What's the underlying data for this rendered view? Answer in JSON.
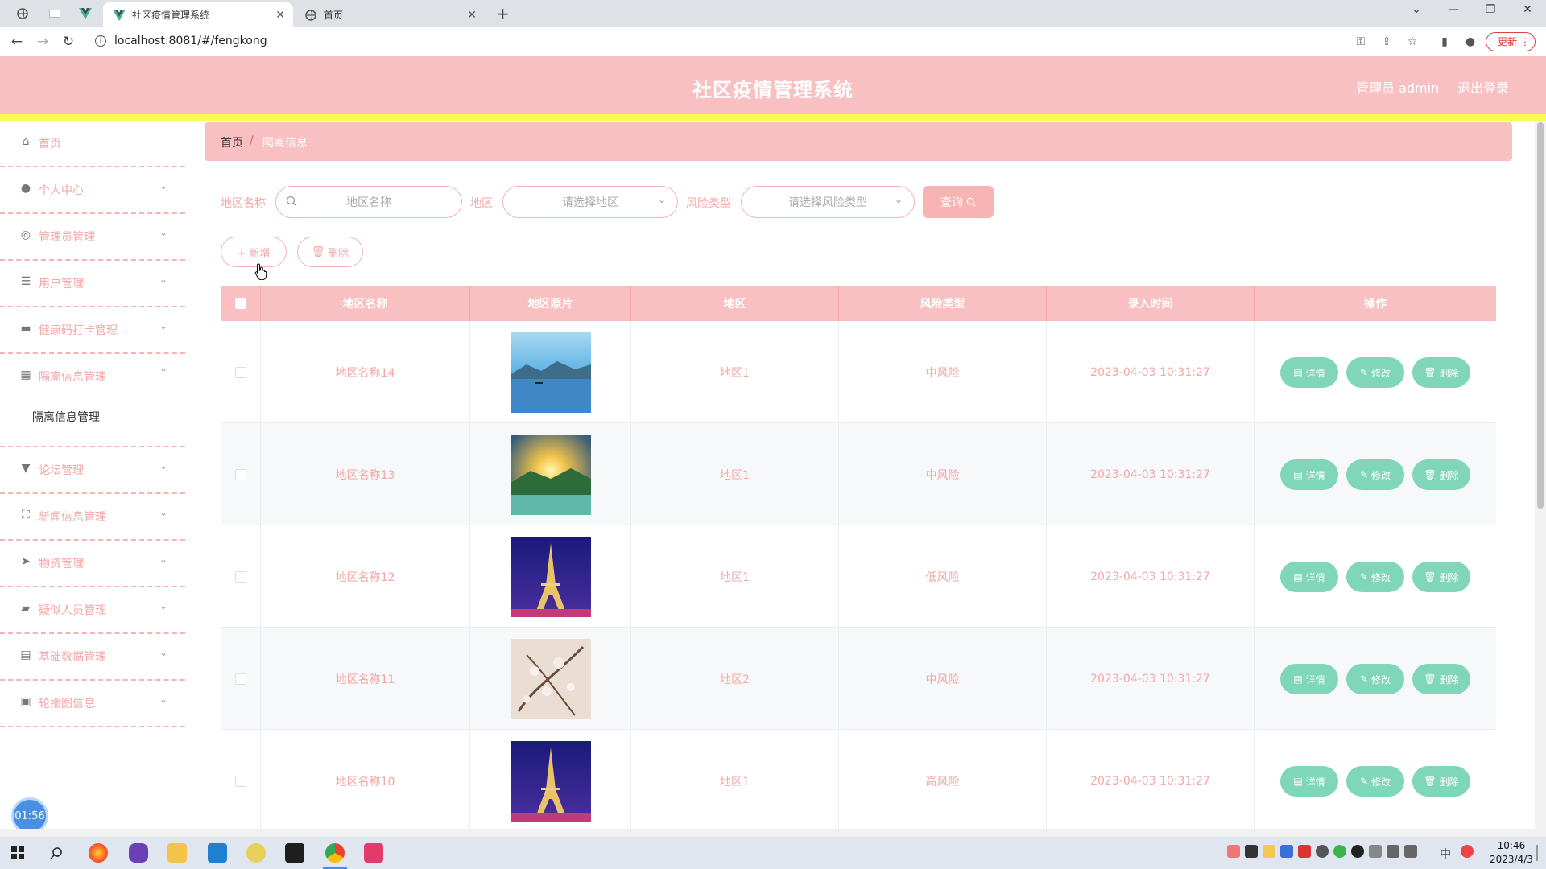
{
  "browser": {
    "tabs": [
      {
        "title": "社区疫情管理系统",
        "active": true
      },
      {
        "title": "首页",
        "active": false
      }
    ],
    "url": "localhost:8081/#/fengkong",
    "update_label": "更新"
  },
  "header": {
    "title": "社区疫情管理系统",
    "admin_label": "管理员 admin",
    "logout_label": "退出登录"
  },
  "sidebar": {
    "items": [
      {
        "label": "首页",
        "icon": "home-icon"
      },
      {
        "label": "个人中心",
        "icon": "user-icon"
      },
      {
        "label": "管理员管理",
        "icon": "settings-icon"
      },
      {
        "label": "用户管理",
        "icon": "sliders-icon"
      },
      {
        "label": "健康码打卡管理",
        "icon": "briefcase-icon"
      },
      {
        "label": "隔离信息管理",
        "icon": "grid-icon"
      },
      {
        "label": "论坛管理",
        "icon": "pin-icon"
      },
      {
        "label": "新闻信息管理",
        "icon": "fullscreen-icon"
      },
      {
        "label": "物资管理",
        "icon": "send-icon"
      },
      {
        "label": "疑似人员管理",
        "icon": "ticket-icon"
      },
      {
        "label": "基础数据管理",
        "icon": "printer-icon"
      },
      {
        "label": "轮播图信息",
        "icon": "trash-icon"
      }
    ],
    "sub_item": "隔离信息管理"
  },
  "breadcrumb": {
    "home": "首页",
    "sep": "/",
    "current": "隔离信息"
  },
  "filters": {
    "name_label": "地区名称",
    "name_placeholder": "地区名称",
    "area_label": "地区",
    "area_placeholder": "请选择地区",
    "risk_label": "风险类型",
    "risk_placeholder": "请选择风险类型",
    "query_label": "查询"
  },
  "toolbar": {
    "add_label": "+ 新增",
    "delete_label": "删除"
  },
  "table": {
    "headers": [
      "地区名称",
      "地区照片",
      "地区",
      "风险类型",
      "录入时间",
      "操作"
    ],
    "rows": [
      {
        "name": "地区名称14",
        "area": "地区1",
        "risk": "中风险",
        "time": "2023-04-03 10:31:27",
        "photo": "lake"
      },
      {
        "name": "地区名称13",
        "area": "地区1",
        "risk": "中风险",
        "time": "2023-04-03 10:31:27",
        "photo": "sunset"
      },
      {
        "name": "地区名称12",
        "area": "地区1",
        "risk": "低风险",
        "time": "2023-04-03 10:31:27",
        "photo": "tower"
      },
      {
        "name": "地区名称11",
        "area": "地区2",
        "risk": "中风险",
        "time": "2023-04-03 10:31:27",
        "photo": "blossom"
      },
      {
        "name": "地区名称10",
        "area": "地区1",
        "risk": "高风险",
        "time": "2023-04-03 10:31:27",
        "photo": "tower"
      }
    ],
    "actions": {
      "detail": "详情",
      "edit": "修改",
      "delete": "删除"
    }
  },
  "timer": "01:56",
  "taskbar": {
    "time": "10:46",
    "date": "2023/4/3",
    "ime": "中"
  }
}
